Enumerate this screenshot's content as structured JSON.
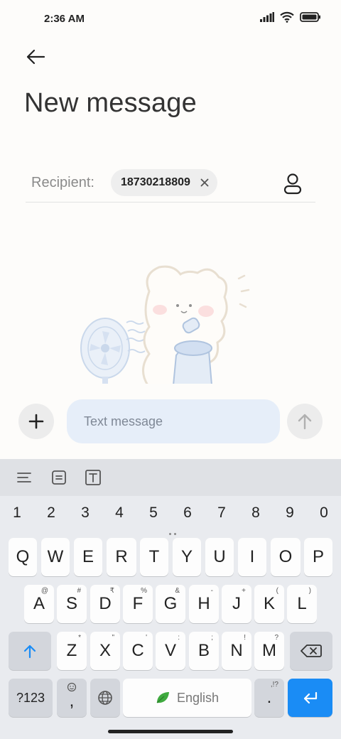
{
  "status_bar": {
    "time": "2:36 AM"
  },
  "header": {
    "title": "New message"
  },
  "recipient": {
    "label": "Recipient:",
    "chip_number": "18730218809"
  },
  "compose": {
    "placeholder": "Text message"
  },
  "keyboard": {
    "number_row": [
      "1",
      "2",
      "3",
      "4",
      "5",
      "6",
      "7",
      "8",
      "9",
      "0"
    ],
    "row1": [
      "Q",
      "W",
      "E",
      "R",
      "T",
      "Y",
      "U",
      "I",
      "O",
      "P"
    ],
    "row2": [
      {
        "key": "A",
        "hint": "@"
      },
      {
        "key": "S",
        "hint": "#"
      },
      {
        "key": "D",
        "hint": "₹"
      },
      {
        "key": "F",
        "hint": "%"
      },
      {
        "key": "G",
        "hint": "&"
      },
      {
        "key": "H",
        "hint": "-"
      },
      {
        "key": "J",
        "hint": "+"
      },
      {
        "key": "K",
        "hint": "("
      },
      {
        "key": "L",
        "hint": ")"
      }
    ],
    "row3": [
      {
        "key": "Z",
        "hint": "*"
      },
      {
        "key": "X",
        "hint": "\""
      },
      {
        "key": "C",
        "hint": "'"
      },
      {
        "key": "V",
        "hint": ":"
      },
      {
        "key": "B",
        "hint": ";"
      },
      {
        "key": "N",
        "hint": "!"
      },
      {
        "key": "M",
        "hint": "?"
      }
    ],
    "symbols_label": "?123",
    "comma_label": ",",
    "period_label": ".",
    "period_hint": ",!?",
    "space_label": "English"
  },
  "icons": {
    "back": "arrow-left-icon",
    "contact": "person-icon",
    "add": "plus-icon",
    "send": "arrow-up-icon",
    "shift": "shift-arrow-icon",
    "backspace": "backspace-icon",
    "globe": "globe-icon",
    "emoji": "emoji-icon",
    "enter": "enter-icon"
  },
  "colors": {
    "accent": "#1a8cf5",
    "input_bg": "#e6eef9"
  }
}
